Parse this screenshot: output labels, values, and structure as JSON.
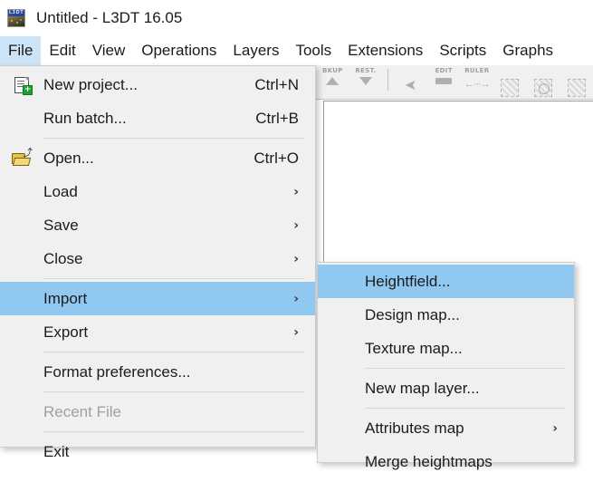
{
  "window": {
    "title": "Untitled - L3DT 16.05",
    "app_icon": "l3dt-app-icon"
  },
  "menubar": {
    "items": [
      {
        "label": "File",
        "open": true
      },
      {
        "label": "Edit",
        "open": false
      },
      {
        "label": "View",
        "open": false
      },
      {
        "label": "Operations",
        "open": false
      },
      {
        "label": "Layers",
        "open": false
      },
      {
        "label": "Tools",
        "open": false
      },
      {
        "label": "Extensions",
        "open": false
      },
      {
        "label": "Scripts",
        "open": false
      },
      {
        "label": "Graphs",
        "open": false
      }
    ]
  },
  "toolbar": {
    "buttons": [
      {
        "caption": "BKUP",
        "icon": "backup-up-arrow-icon"
      },
      {
        "caption": "REST.",
        "icon": "restore-down-arrow-icon"
      },
      {
        "caption": "",
        "icon": "separator"
      },
      {
        "caption": "",
        "icon": "pointer-cursor-icon"
      },
      {
        "caption": "EDIT",
        "icon": "pencil-edit-icon"
      },
      {
        "caption": "RULER",
        "icon": "ruler-measure-icon"
      },
      {
        "caption": "",
        "icon": "select-region-icon"
      },
      {
        "caption": "",
        "icon": "select-ellipse-icon"
      },
      {
        "caption": "",
        "icon": "select-extra-icon"
      }
    ]
  },
  "file_menu": {
    "items": [
      {
        "type": "item",
        "label": "New project...",
        "accel": "Ctrl+N",
        "icon": "new-document-icon",
        "highlighted": false,
        "disabled": false,
        "submenu": false
      },
      {
        "type": "item",
        "label": "Run batch...",
        "accel": "Ctrl+B",
        "icon": "",
        "highlighted": false,
        "disabled": false,
        "submenu": false
      },
      {
        "type": "separator"
      },
      {
        "type": "item",
        "label": "Open...",
        "accel": "Ctrl+O",
        "icon": "open-folder-icon",
        "highlighted": false,
        "disabled": false,
        "submenu": false
      },
      {
        "type": "item",
        "label": "Load",
        "accel": "",
        "icon": "",
        "highlighted": false,
        "disabled": false,
        "submenu": true
      },
      {
        "type": "item",
        "label": "Save",
        "accel": "",
        "icon": "",
        "highlighted": false,
        "disabled": false,
        "submenu": true
      },
      {
        "type": "item",
        "label": "Close",
        "accel": "",
        "icon": "",
        "highlighted": false,
        "disabled": false,
        "submenu": true
      },
      {
        "type": "separator"
      },
      {
        "type": "item",
        "label": "Import",
        "accel": "",
        "icon": "",
        "highlighted": true,
        "disabled": false,
        "submenu": true
      },
      {
        "type": "item",
        "label": "Export",
        "accel": "",
        "icon": "",
        "highlighted": false,
        "disabled": false,
        "submenu": true
      },
      {
        "type": "separator"
      },
      {
        "type": "item",
        "label": "Format preferences...",
        "accel": "",
        "icon": "",
        "highlighted": false,
        "disabled": false,
        "submenu": false
      },
      {
        "type": "separator"
      },
      {
        "type": "item",
        "label": "Recent File",
        "accel": "",
        "icon": "",
        "highlighted": false,
        "disabled": true,
        "submenu": false
      },
      {
        "type": "separator"
      },
      {
        "type": "item",
        "label": "Exit",
        "accel": "",
        "icon": "",
        "highlighted": false,
        "disabled": false,
        "submenu": false
      }
    ]
  },
  "import_submenu": {
    "items": [
      {
        "type": "item",
        "label": "Heightfield...",
        "highlighted": true,
        "submenu": false
      },
      {
        "type": "item",
        "label": "Design map...",
        "highlighted": false,
        "submenu": false
      },
      {
        "type": "item",
        "label": "Texture map...",
        "highlighted": false,
        "submenu": false
      },
      {
        "type": "separator"
      },
      {
        "type": "item",
        "label": "New map layer...",
        "highlighted": false,
        "submenu": false
      },
      {
        "type": "separator"
      },
      {
        "type": "item",
        "label": "Attributes map",
        "highlighted": false,
        "submenu": true
      },
      {
        "type": "item",
        "label": "Merge heightmaps",
        "highlighted": false,
        "submenu": false
      }
    ]
  },
  "colors": {
    "menu_background": "#f0f0f0",
    "highlight": "#90c8f2",
    "menubar_open": "#cce4f7",
    "text": "#1b1b1b",
    "disabled_text": "#a0a0a0",
    "separator": "#d7d7d7",
    "client_background": "#ffffff"
  },
  "glyphs": {
    "submenu_arrow": "›",
    "cursor": "➤",
    "ruler": "←···→",
    "plus": "+",
    "folder_arrow": "⤴"
  }
}
